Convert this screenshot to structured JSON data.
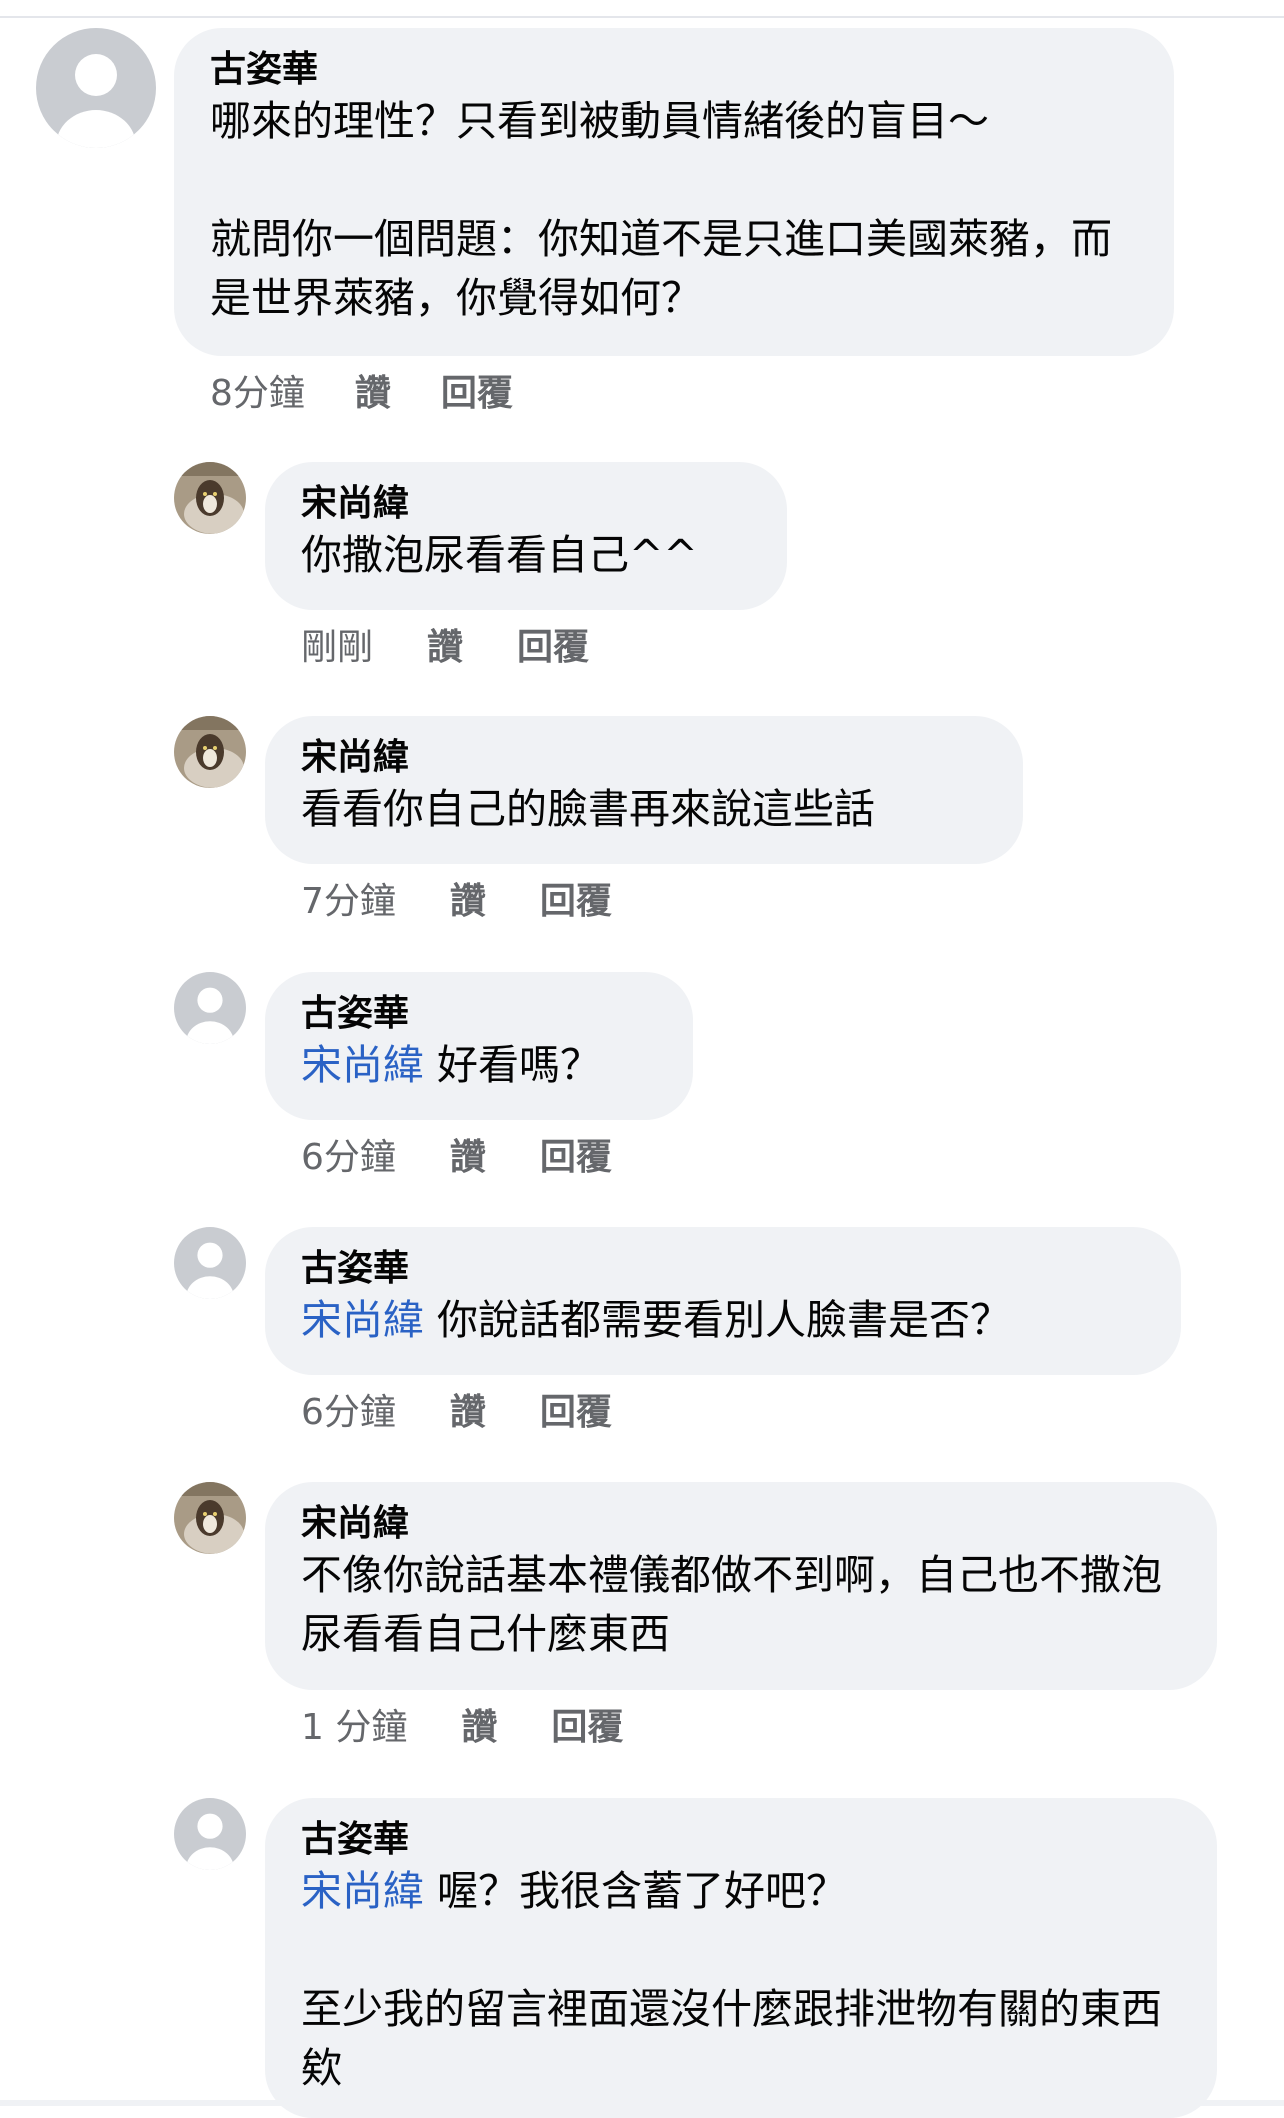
{
  "comments": [
    {
      "author": "古姿華",
      "text": "哪來的理性？只看到被動員情緒後的盲目～\n\n就問你一個問題：你知道不是只進口美國萊豬，而是世界萊豬，你覺得如何？",
      "time": "8分鐘",
      "like_label": "讚",
      "reply_label": "回覆"
    },
    {
      "author": "宋尚緯",
      "text": "你撒泡尿看看自己^^",
      "time": "剛剛",
      "like_label": "讚",
      "reply_label": "回覆"
    },
    {
      "author": "宋尚緯",
      "text": "看看你自己的臉書再來說這些話",
      "time": "7分鐘",
      "like_label": "讚",
      "reply_label": "回覆"
    },
    {
      "author": "古姿華",
      "mention": "宋尚緯",
      "text": "好看嗎？",
      "time": "6分鐘",
      "like_label": "讚",
      "reply_label": "回覆"
    },
    {
      "author": "古姿華",
      "mention": "宋尚緯",
      "text": "你說話都需要看別人臉書是否？",
      "time": "6分鐘",
      "like_label": "讚",
      "reply_label": "回覆"
    },
    {
      "author": "宋尚緯",
      "text": "不像你說話基本禮儀都做不到啊，自己也不撒泡尿看看自己什麼東西",
      "time": "1 分鐘",
      "like_label": "讚",
      "reply_label": "回覆"
    },
    {
      "author": "古姿華",
      "mention": "宋尚緯",
      "text": "喔？我很含蓄了好吧？\n\n至少我的留言裡面還沒什麼跟排泄物有關的東西欸"
    }
  ],
  "colors": {
    "bubble": "#f0f2f5",
    "mention": "#2a62c5",
    "meta": "#65676b"
  }
}
